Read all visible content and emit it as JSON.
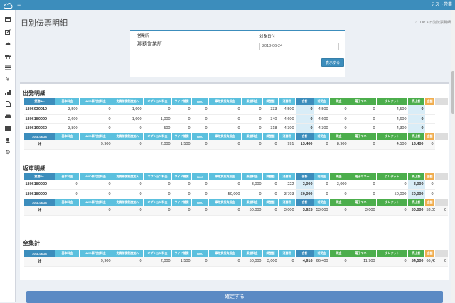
{
  "header": {
    "menu_icon": "hamburger-icon",
    "user": "テスト営業"
  },
  "sidebar": {
    "icons": [
      "dashboard-icon",
      "edit-icon",
      "cloud-icon",
      "truck-icon",
      "list-icon",
      "yen-icon",
      "chart-icon",
      "file-icon",
      "car-icon",
      "box-icon",
      "user-icon",
      "gear-icon"
    ]
  },
  "page": {
    "title": "日別伝票明細",
    "breadcrumb_top": "TOP",
    "breadcrumb_sep": ">",
    "breadcrumb_current": "日別伝票明細"
  },
  "search": {
    "office_label": "営業所",
    "office_value": "那覇営業所",
    "date_label": "対象日付",
    "date_value": "2018-06-24",
    "show_button": "表示する"
  },
  "headers": [
    "基本料金",
    "4WD車付加料金",
    "免責補償制度加入",
    "オプション料金",
    "ワイド補償",
    "NOC",
    "事故負担負担金",
    "乗捨料金",
    "調整額",
    "消費税",
    "合計",
    "前受金",
    "現金",
    "電子マネー",
    "クレジット",
    "売上計",
    "金額"
  ],
  "departures": {
    "title": "出発明細",
    "first_col_header": "貸渡No.",
    "rows": [
      [
        "1806030010",
        "3,500",
        "0",
        "1,000",
        "0",
        "0",
        "0",
        "0",
        "0",
        "333",
        "4,500",
        "0",
        "4,500",
        "0",
        "0",
        "4,500",
        "0"
      ],
      [
        "1806180090",
        "2,600",
        "0",
        "1,000",
        "1,000",
        "0",
        "0",
        "0",
        "0",
        "340",
        "4,600",
        "0",
        "4,600",
        "0",
        "0",
        "4,600",
        "0"
      ],
      [
        "1806190060",
        "3,800",
        "0",
        "0",
        "500",
        "0",
        "0",
        "0",
        "0",
        "318",
        "4,300",
        "0",
        "4,300",
        "0",
        "0",
        "4,300",
        "0"
      ]
    ],
    "date_header": "2018-06-24",
    "total_label": "計",
    "total": [
      "9,900",
      "0",
      "2,000",
      "1,500",
      "0",
      "0",
      "0",
      "0",
      "991",
      "13,400",
      "0",
      "8,900",
      "0",
      "4,500",
      "13,400",
      "0"
    ]
  },
  "returns": {
    "title": "返車明細",
    "first_col_header": "貸渡No.",
    "rows": [
      [
        "1806180020",
        "0",
        "0",
        "0",
        "0",
        "0",
        "0",
        "0",
        "3,000",
        "0",
        "222",
        "3,000",
        "0",
        "3,000",
        "0",
        "0",
        "3,000",
        "0"
      ],
      [
        "1806180090",
        "0",
        "0",
        "0",
        "0",
        "0",
        "0",
        "50,000",
        "0",
        "0",
        "3,703",
        "50,000",
        "0",
        "0",
        "0",
        "50,000",
        "50,000",
        "0"
      ]
    ],
    "date_header": "2018-06-24",
    "total_label": "計",
    "total": [
      "0",
      "0",
      "0",
      "0",
      "0",
      "0",
      "50,000",
      "0",
      "3,000",
      "3,925",
      "53,000",
      "0",
      "3,000",
      "0",
      "50,000",
      "53,000",
      "0"
    ]
  },
  "summary": {
    "title": "全集計",
    "date_header": "2018-06-24",
    "total_label": "計",
    "total": [
      "9,900",
      "0",
      "2,000",
      "1,500",
      "0",
      "0",
      "50,000",
      "3,000",
      "0",
      "4,916",
      "66,400",
      "0",
      "11,900",
      "0",
      "54,500",
      "66,400",
      "0"
    ]
  },
  "confirm_button": "確定する",
  "colors": {
    "header_blue": "#3c8dbc",
    "cell_cyan": "#5bc0de",
    "cash_green": "#4cae4c",
    "amount_orange": "#f0ad4e",
    "highlight": "#d9edf7"
  }
}
